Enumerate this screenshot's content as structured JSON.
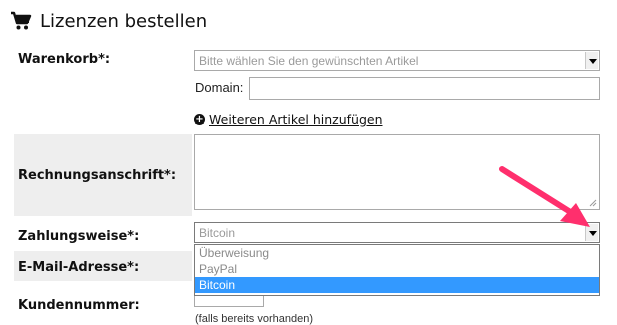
{
  "header": {
    "title": "Lizenzen bestellen"
  },
  "form": {
    "cart": {
      "label": "Warenkorb*:",
      "select_value": "Bitte wählen Sie den gewünschten Artikel",
      "domain_label": "Domain:",
      "domain_value": "",
      "add_item_link": "Weiteren Artikel hinzufügen"
    },
    "billing": {
      "label": "Rechnungsanschrift*:",
      "value": ""
    },
    "payment": {
      "label": "Zahlungsweise*:",
      "select_value": "Bitcoin",
      "options": [
        "Überweisung",
        "PayPal",
        "Bitcoin"
      ],
      "selected_option": "Bitcoin"
    },
    "email": {
      "label": "E-Mail-Adresse*:",
      "value": ""
    },
    "customer_number": {
      "label": "Kundennummer:",
      "value": "",
      "note": "(falls bereits vorhanden)"
    }
  },
  "icons": {
    "cart": "cart-icon",
    "plus": "plus-circle-icon",
    "dropdown": "chevron-down-icon"
  },
  "colors": {
    "row_highlight": "#eeeeee",
    "selected_option": "#3399ff",
    "annotation_arrow": "#ff2f6d"
  }
}
